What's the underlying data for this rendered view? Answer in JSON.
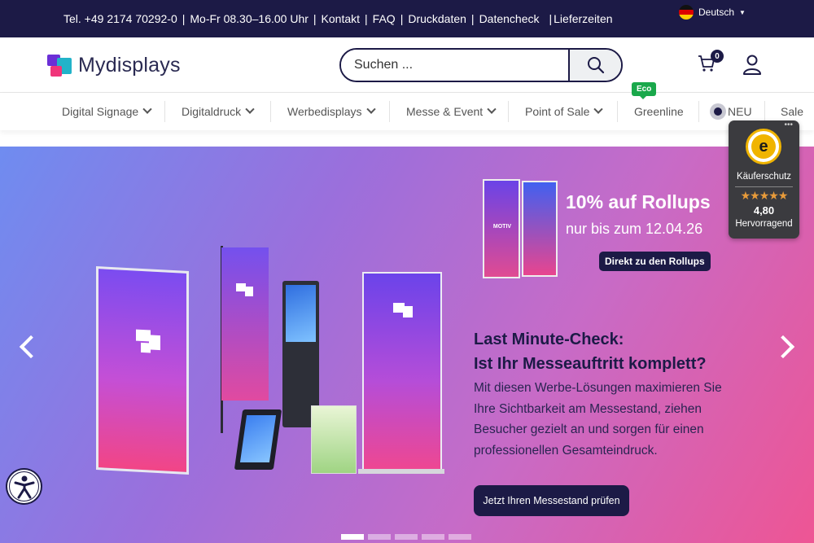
{
  "topbar": {
    "links": [
      "Tel. +49 2174 70292-0",
      "Mo-Fr  08.30–16.00 Uhr",
      "Kontakt",
      "FAQ",
      "Druckdaten",
      "Datencheck",
      "Lieferzeiten"
    ],
    "language": "Deutsch",
    "flag_icon": "german-flag-icon"
  },
  "header": {
    "logo_text": "Mydisplays",
    "search_placeholder": "Suchen ...",
    "search_icon": "search-icon",
    "cart_count": "0",
    "cart_icon": "cart-icon",
    "account_icon": "user-icon"
  },
  "nav": {
    "items": [
      {
        "label": "Digital Signage",
        "has_dropdown": true
      },
      {
        "label": "Digitaldruck",
        "has_dropdown": true
      },
      {
        "label": "Werbedisplays",
        "has_dropdown": true
      },
      {
        "label": "Messe & Event",
        "has_dropdown": true
      },
      {
        "label": "Point of Sale",
        "has_dropdown": true
      },
      {
        "label": "Greenline",
        "has_dropdown": false
      },
      {
        "label": "NEU",
        "has_dropdown": false
      },
      {
        "label": "Sale",
        "has_dropdown": false
      }
    ],
    "eco_badge": "Eco"
  },
  "hero": {
    "promo_title": "10% auf Rollups",
    "promo_sub": "nur bis zum 12.04.26",
    "promo_cta": "Direkt zu den Rollups",
    "motif_label": "MOTIV",
    "headline_line1": "Last Minute-Check:",
    "headline_line2": "Ist Ihr Messeauftritt komplett?",
    "body": "Mit diesen Werbe-Lösungen maximieren Sie Ihre Sichtbarkeit am Messestand, ziehen Besucher gezielt an und sorgen für einen professionellen Gesamteindruck.",
    "cta": "Jetzt Ihren Messestand prüfen",
    "slides": 5,
    "active_slide": 1,
    "prev_icon": "chevron-left-icon",
    "next_icon": "chevron-right-icon"
  },
  "trusted_shops": {
    "label": "Käuferschutz",
    "stars": "★★★★★",
    "score": "4,80",
    "rating_text": "Hervorragend",
    "seal_letter": "e"
  },
  "colors": {
    "navy": "#1c1a46",
    "eco_green": "#1aa84b",
    "accent_pink": "#f0357a",
    "accent_teal": "#22b3c9",
    "accent_purple": "#6b2fd6"
  }
}
